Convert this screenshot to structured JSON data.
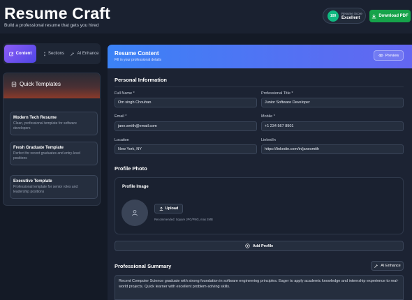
{
  "header": {
    "title": "Resume Craft",
    "subtitle": "Build a professional resume that gets you hired",
    "score": {
      "value": "100",
      "label": "Resume Score",
      "rating": "Excellent",
      "color": "#10b981"
    },
    "download_label": "Download PDF"
  },
  "sidebar": {
    "tabs": [
      {
        "label": "Content",
        "icon": "edit-icon"
      },
      {
        "label": "Sections",
        "icon": "menu-dots-icon"
      },
      {
        "label": "AI Enhance",
        "icon": "magic-wand-icon"
      }
    ],
    "templates": {
      "title": "Quick Templates",
      "items": [
        {
          "name": "Modern Tech Resume",
          "description": "Clean, professional template for software developers"
        },
        {
          "name": "Fresh Graduate Template",
          "description": "Perfect for recent graduates and entry-level positions"
        },
        {
          "name": "Executive Template",
          "description": "Professional template for senior roles and leadership positions"
        }
      ]
    }
  },
  "main": {
    "title": "Resume Content",
    "subtitle": "Fill in your professional details",
    "preview_label": "Preview",
    "personal": {
      "title": "Personal Information",
      "full_name": {
        "label": "Full Name *",
        "value": "Om singh Chouhan"
      },
      "professional_title": {
        "label": "Professional Title *",
        "value": "Junior Software Developer"
      },
      "email": {
        "label": "Email *",
        "value": "jane.smith@email.com"
      },
      "mobile": {
        "label": "Mobile *",
        "value": "+1 234 567 8901"
      },
      "location": {
        "label": "Location",
        "value": "New York, NY"
      },
      "linkedin": {
        "label": "LinkedIn",
        "value": "https://linkedin.com/in/janesmith"
      }
    },
    "photo": {
      "section_title": "Profile Photo",
      "box_title": "Profile Image",
      "upload_label": "Upload",
      "hint": "Recommended: Square JPG/PNG, max 2MB"
    },
    "add_profile_label": "Add Profile",
    "summary": {
      "title": "Professional Summary",
      "ai_label": "AI Enhance",
      "text": "Recent Computer Science graduate with strong foundation in software engineering principles. Eager to apply academic knowledge and internship experience to real-world projects. Quick learner with excellent problem-solving skills."
    }
  }
}
